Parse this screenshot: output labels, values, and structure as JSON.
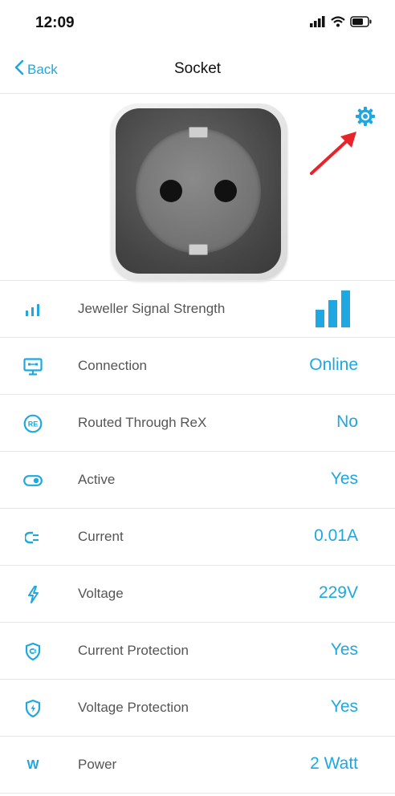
{
  "status_bar": {
    "time": "12:09",
    "icons": [
      "cellular-signal-icon",
      "wifi-icon",
      "battery-icon"
    ]
  },
  "nav": {
    "back_label": "Back",
    "title": "Socket"
  },
  "accent_color": "#1ea7e1",
  "annotation_arrow_color": "#e8242b",
  "rows": [
    {
      "label": "Jeweller Signal Strength",
      "icon": "signal-strength-icon",
      "signal_level": 3,
      "signal_max": 3
    },
    {
      "label": "Connection",
      "icon": "connection-icon",
      "value": "Online"
    },
    {
      "label": "Routed Through ReX",
      "icon": "rex-icon",
      "icon_text": "RE",
      "value": "No"
    },
    {
      "label": "Active",
      "icon": "toggle-icon",
      "value": "Yes"
    },
    {
      "label": "Current",
      "icon": "plug-icon",
      "value": "0.01A"
    },
    {
      "label": "Voltage",
      "icon": "lightning-icon",
      "value": "229V"
    },
    {
      "label": "Current Protection",
      "icon": "shield-current-icon",
      "value": "Yes"
    },
    {
      "label": "Voltage Protection",
      "icon": "shield-voltage-icon",
      "value": "Yes"
    },
    {
      "label": "Power",
      "icon": "power-icon",
      "icon_text": "W",
      "value": "2 Watt"
    }
  ]
}
